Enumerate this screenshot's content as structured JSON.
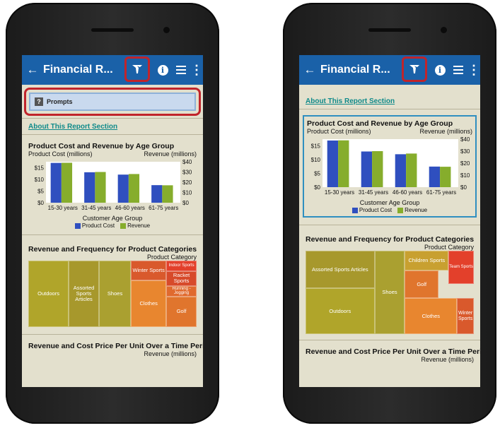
{
  "app": {
    "title": "Financial R...",
    "back_glyph": "←",
    "info_glyph": "i",
    "more_glyph": "⋮"
  },
  "icons": {
    "back": "back-arrow-icon",
    "filter": "filter-icon",
    "info": "info-icon",
    "list": "list-icon",
    "more": "more-vert-icon",
    "prompt": "question-icon"
  },
  "colors": {
    "appbar": "#1a61a8",
    "background": "#e3e0cd",
    "highlight": "#c0242b",
    "product_cost": "#2f4fbf",
    "revenue": "#86ad2c",
    "link": "#0f8a8a"
  },
  "left": {
    "prompts_label": "Prompts",
    "prompts_icon_glyph": "?",
    "about_link": "About This Report Section",
    "section1_title": "Product Cost and Revenue by Age Group",
    "section2_title": "Revenue and Frequency for Product Categories",
    "section2_sub": "Product Category",
    "section3_title": "Revenue and Cost Price Per Unit Over a Time Period",
    "section3_sub": "Revenue (millions)"
  },
  "right": {
    "about_link": "About This Report Section",
    "section1_title": "Product Cost and Revenue by Age Group",
    "section2_title": "Revenue and Frequency for Product Categories",
    "section2_sub": "Product Category",
    "section3_title": "Revenue and Cost Price Per Unit Over a Time Period",
    "section3_sub": "Revenue (millions)"
  },
  "chart_data": {
    "type": "bar",
    "title": "Product Cost and Revenue by Age Group",
    "xlabel": "Customer Age Group",
    "ylabel": "Product Cost (millions)",
    "y2label": "Revenue (millions)",
    "categories": [
      "15-30 years",
      "31-45 years",
      "46-60 years",
      "61-75 years"
    ],
    "series": [
      {
        "name": "Product Cost",
        "axis": "left",
        "values": [
          17,
          13,
          12,
          7.5
        ]
      },
      {
        "name": "Revenue",
        "axis": "right",
        "values": [
          39,
          30,
          28,
          17
        ]
      }
    ],
    "ylim": [
      0,
      17.5
    ],
    "y2lim": [
      0,
      40
    ],
    "yticks": [
      "$0",
      "$5",
      "$10",
      "$15"
    ],
    "y2ticks": [
      "$0",
      "$10",
      "$20",
      "$30",
      "$40"
    ],
    "legend_position": "bottom",
    "grid": false
  },
  "treemap_left": [
    {
      "label": "Outdoors",
      "color": "#b0a52a"
    },
    {
      "label": "Assorted Sports Articles",
      "color": "#a7982c"
    },
    {
      "label": "Shoes",
      "color": "#aaa030"
    },
    {
      "label": "Winter Sports",
      "color": "#d9592c"
    },
    {
      "label": "Indoor Sports",
      "color": "#e3402b"
    },
    {
      "label": "Racket Sports",
      "color": "#d74a2a"
    },
    {
      "label": "Running - Jogging",
      "color": "#e06a2e"
    },
    {
      "label": "Clothes",
      "color": "#e8862f"
    },
    {
      "label": "Golf",
      "color": "#e0752d"
    }
  ],
  "treemap_right": [
    {
      "label": "Assorted Sports Articles",
      "color": "#a7982c"
    },
    {
      "label": "Outdoors",
      "color": "#b0a52a"
    },
    {
      "label": "Shoes",
      "color": "#aaa030"
    },
    {
      "label": "Children Sports",
      "color": "#c8a030"
    },
    {
      "label": "Golf",
      "color": "#e0752d"
    },
    {
      "label": "Clothes",
      "color": "#e8862f"
    },
    {
      "label": "Team Sports",
      "color": "#e3402b"
    },
    {
      "label": "Winter Sports",
      "color": "#d9592c"
    }
  ]
}
